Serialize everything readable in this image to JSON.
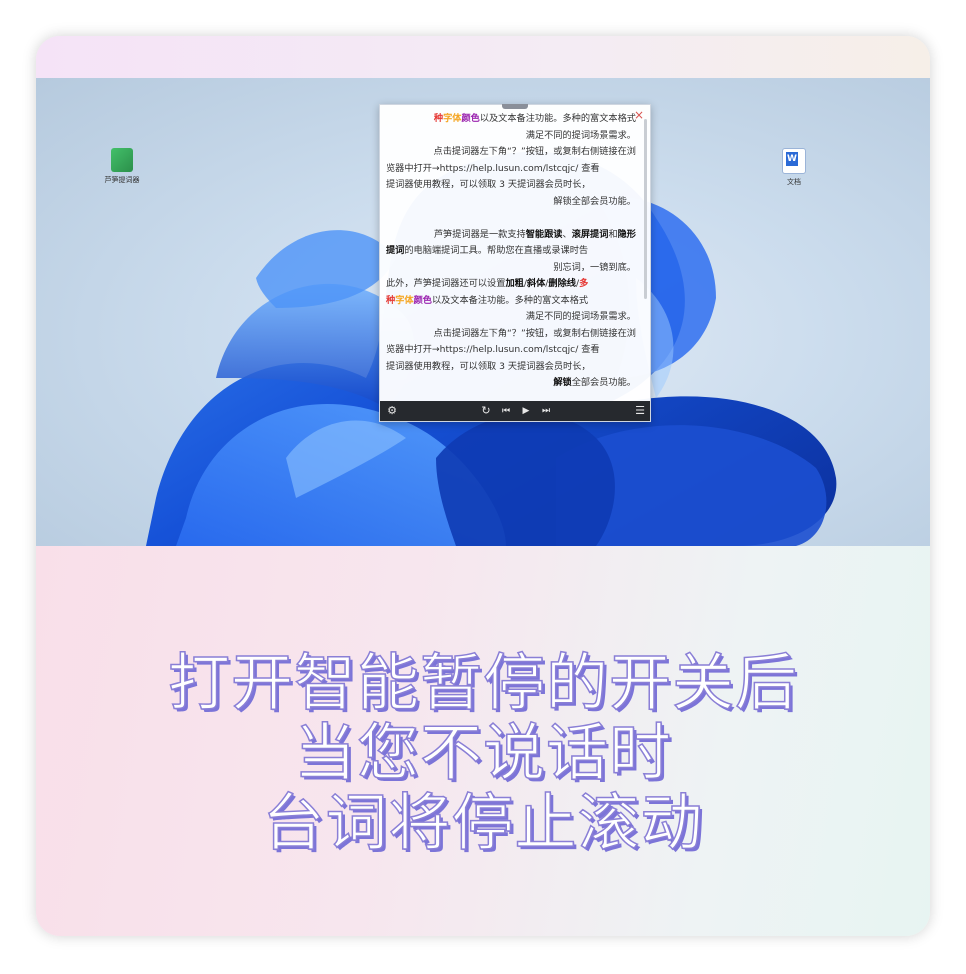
{
  "desktop": {
    "icons": [
      {
        "name": "app-shortcut-icon",
        "label": "芦笋提词器"
      },
      {
        "name": "word-document-icon",
        "label": "文档"
      }
    ]
  },
  "prompter": {
    "lines": [
      {
        "segments": [
          {
            "t": "种",
            "c": "#e53935",
            "b": true
          },
          {
            "t": "字体",
            "c": "#f5a623",
            "b": true
          },
          {
            "t": "颜色",
            "c": "#9c27b0",
            "b": true
          },
          {
            "t": "以及文本备注功能。多种的富文本格式",
            "c": "#333333",
            "b": false
          }
        ],
        "align": "right"
      },
      {
        "segments": [
          {
            "t": "满足不同的提词场景需求。",
            "c": "#333333",
            "b": false
          }
        ],
        "align": "right"
      },
      {
        "segments": [
          {
            "t": "点击提词器左下角“？”按钮，或复制右侧链接在浏",
            "c": "#333333",
            "b": false
          }
        ],
        "align": "right"
      },
      {
        "segments": [
          {
            "t": "览器中打开→https://help.lusun.com/lstcqjc/ 查看",
            "c": "#333333",
            "b": false
          }
        ],
        "align": "left"
      },
      {
        "segments": [
          {
            "t": "提词器使用教程，可以领取 3 天提词器会员时长，",
            "c": "#333333",
            "b": false
          }
        ],
        "align": "left"
      },
      {
        "segments": [
          {
            "t": "解锁全部会员功能。",
            "c": "#333333",
            "b": false
          }
        ],
        "align": "right"
      },
      {
        "segments": [],
        "align": "left"
      },
      {
        "segments": [
          {
            "t": "芦笋提词器是一款支持",
            "c": "#333333",
            "b": false
          },
          {
            "t": "智能跟读",
            "c": "#111111",
            "b": true
          },
          {
            "t": "、",
            "c": "#333333",
            "b": false
          },
          {
            "t": "滚屏提词",
            "c": "#111111",
            "b": true
          },
          {
            "t": "和",
            "c": "#333333",
            "b": false
          },
          {
            "t": "隐形",
            "c": "#111111",
            "b": true
          }
        ],
        "align": "right"
      },
      {
        "segments": [
          {
            "t": "提词",
            "c": "#111111",
            "b": true
          },
          {
            "t": "的电脑端提词工具。帮助您在直播或录课时告",
            "c": "#333333",
            "b": false
          }
        ],
        "align": "left"
      },
      {
        "segments": [
          {
            "t": "别忘词，一镜到底。",
            "c": "#333333",
            "b": false
          }
        ],
        "align": "right"
      },
      {
        "segments": [
          {
            "t": "此外，芦笋提词器还可以设置",
            "c": "#333333",
            "b": false
          },
          {
            "t": "加粗",
            "c": "#111111",
            "b": true
          },
          {
            "t": "/",
            "c": "#333333",
            "b": false
          },
          {
            "t": "斜体",
            "c": "#111111",
            "b": true
          },
          {
            "t": "/",
            "c": "#333333",
            "b": false
          },
          {
            "t": "删除线",
            "c": "#111111",
            "b": true
          },
          {
            "t": "/",
            "c": "#333333",
            "b": false
          },
          {
            "t": "多",
            "c": "#e53935",
            "b": true
          }
        ],
        "align": "left"
      },
      {
        "segments": [
          {
            "t": "种",
            "c": "#e53935",
            "b": true
          },
          {
            "t": "字体",
            "c": "#f5a623",
            "b": true
          },
          {
            "t": "颜色",
            "c": "#9c27b0",
            "b": true
          },
          {
            "t": "以及文本备注功能。多种的富文本格式",
            "c": "#333333",
            "b": false
          }
        ],
        "align": "left"
      },
      {
        "segments": [
          {
            "t": "满足不同的提词场景需求。",
            "c": "#333333",
            "b": false
          }
        ],
        "align": "right"
      },
      {
        "segments": [
          {
            "t": "点击提词器左下角“？”按钮，或复制右侧链接在浏",
            "c": "#333333",
            "b": false
          }
        ],
        "align": "right"
      },
      {
        "segments": [
          {
            "t": "览器中打开→https://help.lusun.com/lstcqjc/ 查看",
            "c": "#333333",
            "b": false
          }
        ],
        "align": "left"
      },
      {
        "segments": [
          {
            "t": "提词器使用教程，可以领取 3 天提词器会员时长，",
            "c": "#333333",
            "b": false
          }
        ],
        "align": "left"
      },
      {
        "segments": [
          {
            "t": "解锁",
            "c": "#111111",
            "b": true
          },
          {
            "t": "全部会员功能。",
            "c": "#333333",
            "b": false
          }
        ],
        "align": "right"
      }
    ],
    "toolbar": {
      "settings_icon": "⚙",
      "reset_icon": "↻",
      "prev_icon": "⏮",
      "play_icon": "▶",
      "next_icon": "⏭",
      "list_icon": "☰"
    },
    "close_icon": "×"
  },
  "captions": [
    "打开智能暂停的开关后",
    "当您不说话时",
    "台词将停止滚动"
  ],
  "colors": {
    "accent_blue": "#1e5fe0",
    "caption_outline": "#7c74d8"
  }
}
